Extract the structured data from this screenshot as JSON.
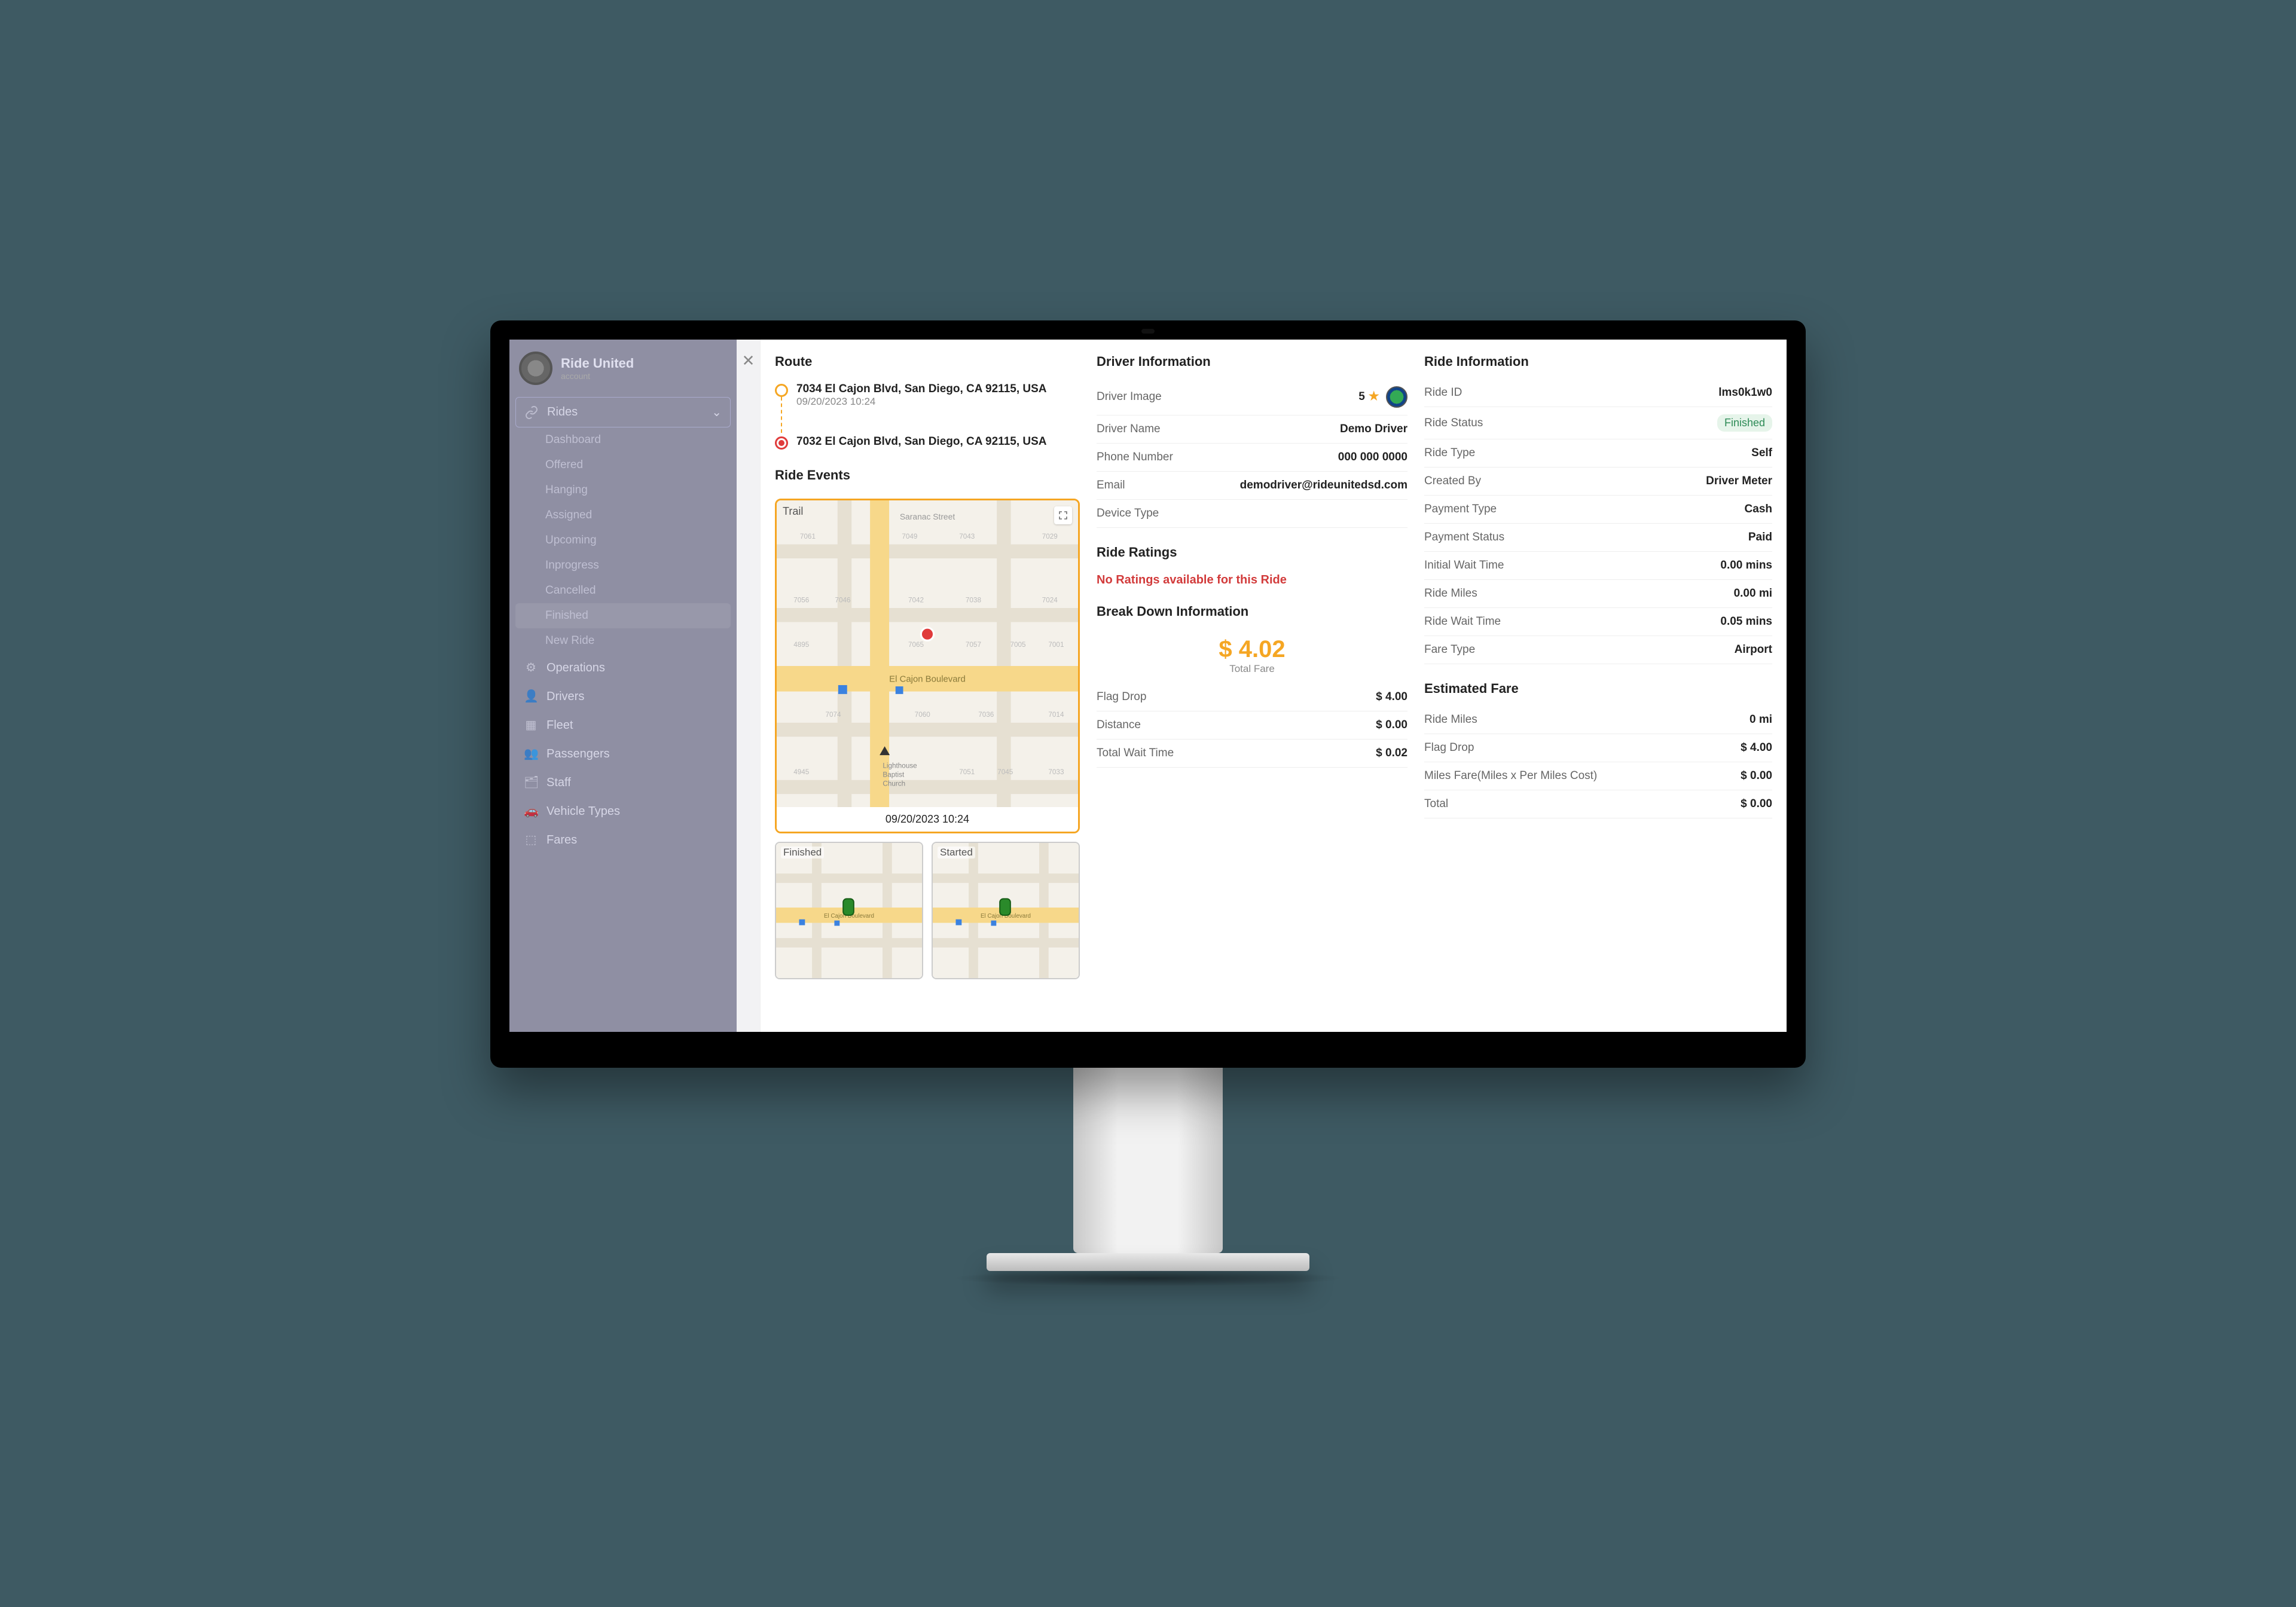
{
  "brand": {
    "title": "Ride United",
    "subtitle": "account"
  },
  "sidebar": {
    "active": "Rides",
    "rides_label": "Rides",
    "rides_children": [
      "Dashboard",
      "Offered",
      "Hanging",
      "Assigned",
      "Upcoming",
      "Inprogress",
      "Cancelled",
      "Finished",
      "New Ride"
    ],
    "items": [
      "Operations",
      "Drivers",
      "Fleet",
      "Passengers",
      "Staff",
      "Vehicle Types",
      "Fares"
    ]
  },
  "route": {
    "heading": "Route",
    "pickup": {
      "address": "7034 El Cajon Blvd, San Diego, CA 92115, USA",
      "time": "09/20/2023 10:24"
    },
    "dropoff": {
      "address": "7032 El Cajon Blvd, San Diego, CA 92115, USA"
    }
  },
  "ride_events": {
    "heading": "Ride Events",
    "main_label": "Trail",
    "main_time": "09/20/2023 10:24",
    "mini": [
      "Finished",
      "Started"
    ]
  },
  "driver": {
    "heading": "Driver Information",
    "rows": {
      "image_label": "Driver Image",
      "rating": "5",
      "name_label": "Driver Name",
      "name": "Demo Driver",
      "phone_label": "Phone Number",
      "phone": "000 000 0000",
      "email_label": "Email",
      "email": "demodriver@rideunitedsd.com",
      "device_label": "Device Type",
      "device": ""
    }
  },
  "ratings": {
    "heading": "Ride Ratings",
    "message": "No Ratings available for this Ride"
  },
  "breakdown": {
    "heading": "Break Down Information",
    "total": "$ 4.02",
    "total_label": "Total Fare",
    "rows": [
      {
        "k": "Flag Drop",
        "v": "$ 4.00"
      },
      {
        "k": "Distance",
        "v": "$ 0.00"
      },
      {
        "k": "Total Wait Time",
        "v": "$ 0.02"
      }
    ]
  },
  "ride_info": {
    "heading": "Ride Information",
    "rows": [
      {
        "k": "Ride ID",
        "v": "lms0k1w0"
      },
      {
        "k": "Ride Status",
        "v": "Finished",
        "badge": true
      },
      {
        "k": "Ride Type",
        "v": "Self"
      },
      {
        "k": "Created By",
        "v": "Driver Meter"
      },
      {
        "k": "Payment Type",
        "v": "Cash"
      },
      {
        "k": "Payment Status",
        "v": "Paid"
      },
      {
        "k": "Initial Wait Time",
        "v": "0.00 mins"
      },
      {
        "k": "Ride Miles",
        "v": "0.00 mi"
      },
      {
        "k": "Ride Wait Time",
        "v": "0.05 mins"
      },
      {
        "k": "Fare Type",
        "v": "Airport"
      }
    ]
  },
  "estimate": {
    "heading": "Estimated Fare",
    "rows": [
      {
        "k": "Ride Miles",
        "v": "0 mi"
      },
      {
        "k": "Flag Drop",
        "v": "$ 4.00"
      },
      {
        "k": "Miles Fare(Miles x Per Miles Cost)",
        "v": "$ 0.00"
      },
      {
        "k": "Total",
        "v": "$ 0.00"
      }
    ]
  }
}
